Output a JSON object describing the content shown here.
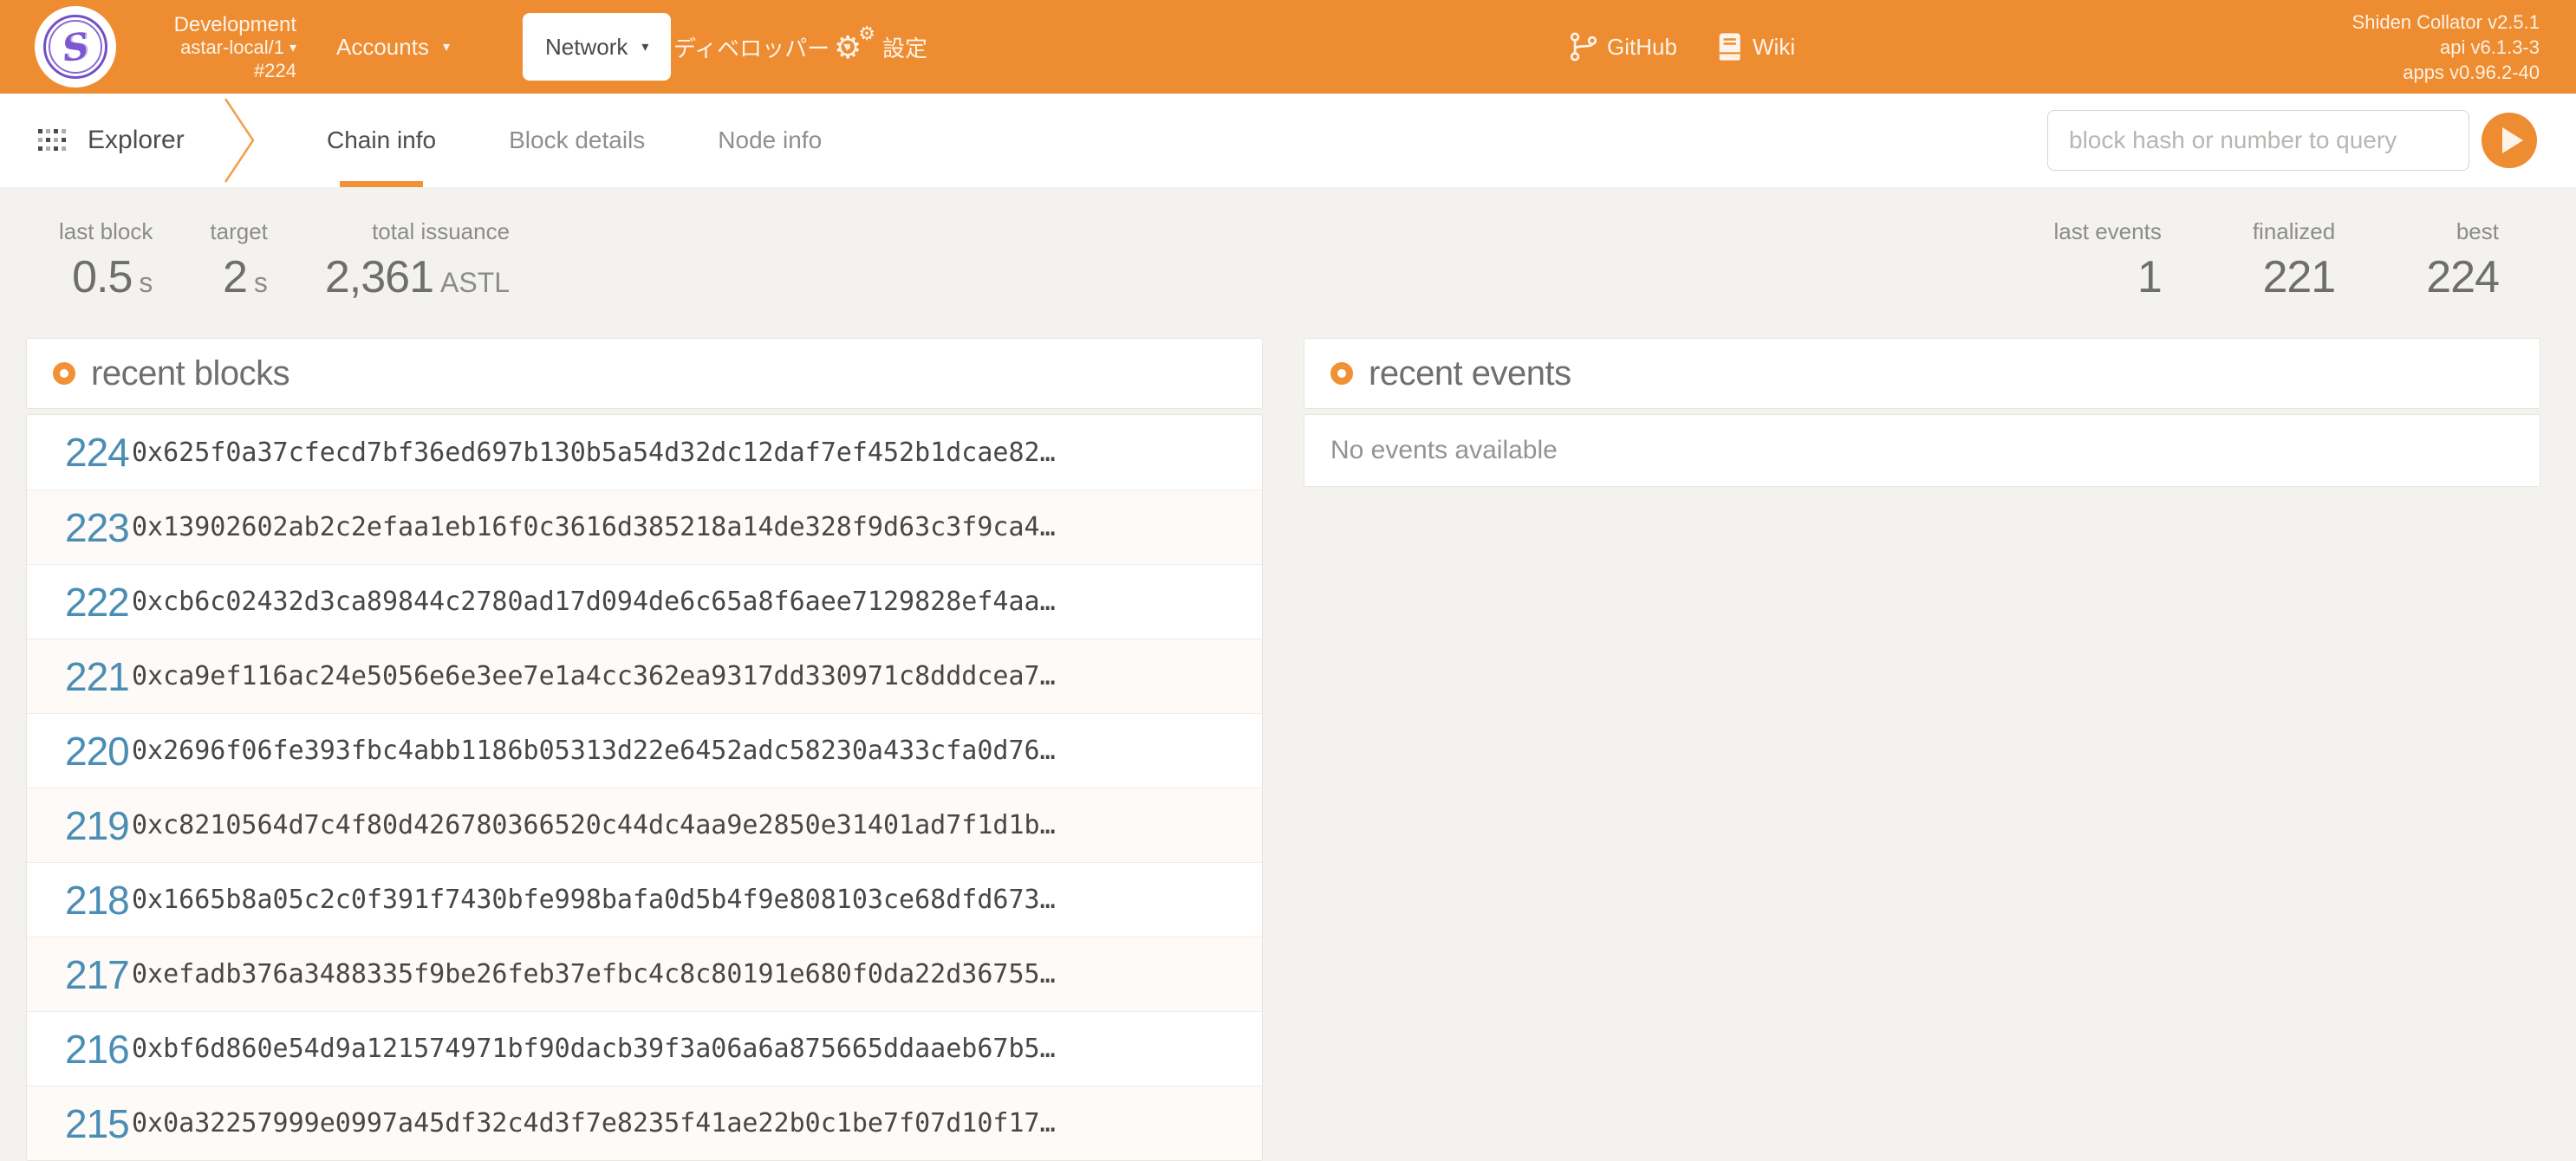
{
  "icons": {
    "caret": "▾",
    "gear": "⚙"
  },
  "colors": {
    "header_orange": "#ee8c31",
    "accent_orange": "#f19135",
    "block_number_blue": "#4a8db5",
    "logo_purple": "#7450c8"
  },
  "header": {
    "chain": {
      "name": "Development",
      "network": "astar-local/1",
      "best_block": "#224"
    },
    "menu": {
      "accounts": "Accounts",
      "network": "Network",
      "developer": "ディベロッパー",
      "settings": "設定"
    },
    "links": {
      "github": "GitHub",
      "wiki": "Wiki"
    },
    "version": {
      "node": "Shiden Collator v2.5.1",
      "api": "api v6.1.3-3",
      "apps": "apps v0.96.2-40"
    }
  },
  "toolbar": {
    "app_label": "Explorer",
    "tabs": [
      {
        "label": "Chain info"
      },
      {
        "label": "Block details"
      },
      {
        "label": "Node info"
      }
    ],
    "search": {
      "placeholder": "block hash or number to query"
    }
  },
  "stats": {
    "left": [
      {
        "label": "last block",
        "value": "0.5",
        "unit": "s"
      },
      {
        "label": "target",
        "value": "2",
        "unit": "s"
      },
      {
        "label": "total issuance",
        "value": "2,361",
        "unit": "ASTL"
      }
    ],
    "right": [
      {
        "label": "last events",
        "value": "1"
      },
      {
        "label": "finalized",
        "value": "221"
      },
      {
        "label": "best",
        "value": "224"
      }
    ]
  },
  "recent_blocks": {
    "title": "recent blocks",
    "rows": [
      {
        "number": "224",
        "hash": "0x625f0a37cfecd7bf36ed697b130b5a54d32dc12daf7ef452b1dcae82…"
      },
      {
        "number": "223",
        "hash": "0x13902602ab2c2efaa1eb16f0c3616d385218a14de328f9d63c3f9ca4…"
      },
      {
        "number": "222",
        "hash": "0xcb6c02432d3ca89844c2780ad17d094de6c65a8f6aee7129828ef4aa…"
      },
      {
        "number": "221",
        "hash": "0xca9ef116ac24e5056e6e3ee7e1a4cc362ea9317dd330971c8dddcea7…"
      },
      {
        "number": "220",
        "hash": "0x2696f06fe393fbc4abb1186b05313d22e6452adc58230a433cfa0d76…"
      },
      {
        "number": "219",
        "hash": "0xc8210564d7c4f80d426780366520c44dc4aa9e2850e31401ad7f1d1b…"
      },
      {
        "number": "218",
        "hash": "0x1665b8a05c2c0f391f7430bfe998bafa0d5b4f9e808103ce68dfd673…"
      },
      {
        "number": "217",
        "hash": "0xefadb376a3488335f9be26feb37efbc4c8c80191e680f0da22d36755…"
      },
      {
        "number": "216",
        "hash": "0xbf6d860e54d9a121574971bf90dacb39f3a06a6a875665ddaaeb67b5…"
      },
      {
        "number": "215",
        "hash": "0x0a32257999e0997a45df32c4d3f7e8235f41ae22b0c1be7f07d10f17…"
      }
    ]
  },
  "recent_events": {
    "title": "recent events",
    "empty_message": "No events available"
  }
}
